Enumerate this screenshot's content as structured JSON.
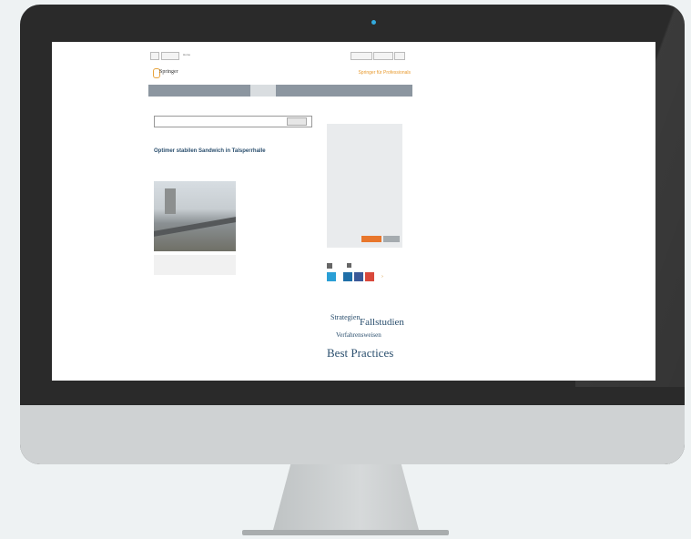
{
  "topbar": {
    "items": [
      "",
      "",
      "Home"
    ],
    "right": [
      "",
      "",
      ""
    ]
  },
  "logo": {
    "text": "Springer",
    "brand_right": "Springer für Professionals"
  },
  "nav": {
    "items": [
      "",
      "",
      "",
      "",
      ""
    ]
  },
  "sub_links": "",
  "search": {
    "button_label": "",
    "hint": ""
  },
  "breadcrumb": "",
  "article": {
    "category": "",
    "headline": "Optimer stabilen Sandwich in Talsperrhalle",
    "caption": "",
    "body_text": "",
    "section_heading": "",
    "paragraph": ""
  },
  "sidebar": {
    "title": "",
    "subtitle": "",
    "lines": [
      "",
      ""
    ],
    "options": [
      "",
      "",
      "",
      "",
      ""
    ],
    "buttons": [
      "",
      ""
    ]
  },
  "share": {
    "icons": [
      "twitter-icon",
      "linkedin-icon",
      "facebook-icon",
      "google-plus-icon"
    ]
  },
  "tagcloud": [
    "Strategien",
    "Fallstudien",
    "Verfahrensweisen",
    "Best Practices"
  ],
  "colors": {
    "accent": "#e89a2e",
    "nav": "#8c96a0",
    "headline": "#2b4f6e",
    "bezel": "#2a2a2a"
  }
}
